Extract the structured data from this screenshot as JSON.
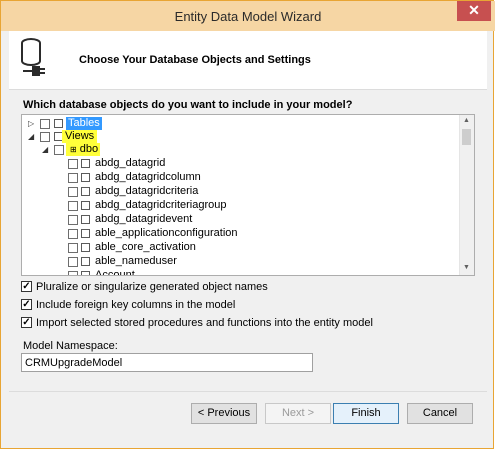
{
  "window": {
    "title": "Entity Data Model Wizard",
    "close_glyph": "✕"
  },
  "header": {
    "title": "Choose Your Database Objects and Settings",
    "icon": "database-plug-icon"
  },
  "prompt": "Which database objects do you want to include in your model?",
  "tree": {
    "tables_label": "Tables",
    "views_label": "Views",
    "dbo_label": "dbo",
    "view_items": [
      "abdg_datagrid",
      "abdg_datagridcolumn",
      "abdg_datagridcriteria",
      "abdg_datagridcriteriagroup",
      "abdg_datagridevent",
      "able_applicationconfiguration",
      "able_core_activation",
      "able_nameduser",
      "Account"
    ]
  },
  "options": {
    "pluralize": {
      "label": "Pluralize or singularize generated object names",
      "checked": true
    },
    "foreign_keys": {
      "label": "Include foreign key columns in the model",
      "checked": true
    },
    "stored_procs": {
      "label": "Import selected stored procedures and functions into the entity model",
      "checked": true
    }
  },
  "namespace": {
    "label": "Model Namespace:",
    "value": "CRMUpgradeModel"
  },
  "buttons": {
    "previous": "< Previous",
    "next": "Next >",
    "finish": "Finish",
    "cancel": "Cancel"
  },
  "colors": {
    "titlebar": "#f6d6a4",
    "border": "#e8a534",
    "highlight": "#ffff3a",
    "selection": "#3399ff",
    "close": "#c75050"
  }
}
